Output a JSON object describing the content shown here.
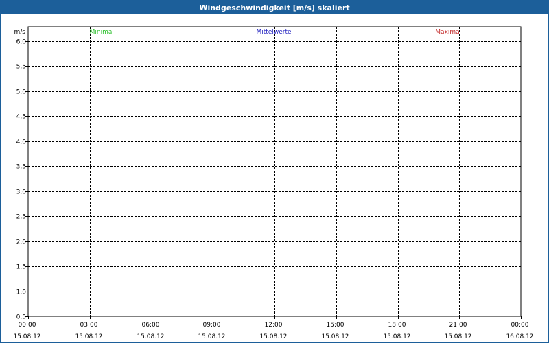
{
  "window": {
    "title": "Windgeschwindigkeit [m/s] skaliert"
  },
  "chart_data": {
    "type": "line",
    "title": "Windgeschwindigkeit [m/s] skaliert",
    "ylabel": "m/s",
    "ylim": [
      0.5,
      6.0
    ],
    "y_ticks": [
      "0,5",
      "1,0",
      "1,5",
      "2,0",
      "2,5",
      "3,0",
      "3,5",
      "4,0",
      "4,5",
      "5,0",
      "5,5",
      "6,0"
    ],
    "x_ticks": [
      {
        "time": "00:00",
        "date": "15.08.12"
      },
      {
        "time": "03:00",
        "date": "15.08.12"
      },
      {
        "time": "06:00",
        "date": "15.08.12"
      },
      {
        "time": "09:00",
        "date": "15.08.12"
      },
      {
        "time": "12:00",
        "date": "15.08.12"
      },
      {
        "time": "15:00",
        "date": "15.08.12"
      },
      {
        "time": "18:00",
        "date": "15.08.12"
      },
      {
        "time": "21:00",
        "date": "15.08.12"
      },
      {
        "time": "00:00",
        "date": "16.08.12"
      }
    ],
    "series": [
      {
        "name": "Minima",
        "color": "#2bbf2b",
        "values": []
      },
      {
        "name": "Mittelwerte",
        "color": "#1f1fbf",
        "values": []
      },
      {
        "name": "Maxima",
        "color": "#c01f1f",
        "values": []
      }
    ],
    "grid": true
  }
}
